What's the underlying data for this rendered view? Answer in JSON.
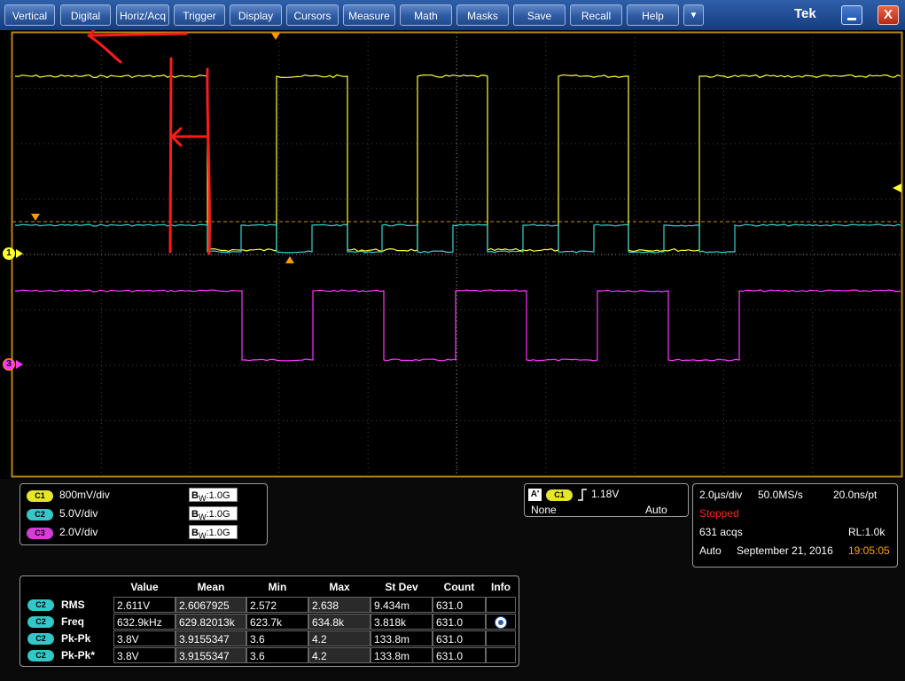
{
  "menu": {
    "items": [
      "Vertical",
      "Digital",
      "Horiz/Acq",
      "Trigger",
      "Display",
      "Cursors",
      "Measure",
      "Math",
      "Masks",
      "Save",
      "Recall",
      "Help"
    ],
    "dropdown_icon": "chevron-down-icon",
    "brand": "Tek",
    "minimize_icon": "minimize-icon",
    "close_label": "X"
  },
  "markers": {
    "ch1": "1",
    "ch3": "3"
  },
  "colors": {
    "ch1": "#ffff33",
    "ch2": "#33d6d6",
    "ch3": "#ff33ff",
    "annotation": "#ff1a1a",
    "trigger_level": "#ff9900",
    "menu_bar": "#1f4a94"
  },
  "channels": [
    {
      "badge": "C1",
      "scale": "800mV/div",
      "bw_b": "B",
      "bw_w": "W",
      "bw_value": ":1.0G",
      "color": "#e5e52b"
    },
    {
      "badge": "C2",
      "scale": "5.0V/div",
      "bw_b": "B",
      "bw_w": "W",
      "bw_value": ":1.0G",
      "color": "#33c8c8"
    },
    {
      "badge": "C3",
      "scale": "2.0V/div",
      "bw_b": "B",
      "bw_w": "W",
      "bw_value": ":1.0G",
      "color": "#d63cd6"
    }
  ],
  "trigger": {
    "badge_a": "A'",
    "badge_ch": "C1",
    "edge_icon": "rising-edge-icon",
    "level": "1.18V",
    "source": "None",
    "mode": "Auto"
  },
  "acquisition": {
    "time_div": "2.0µs/div",
    "sample_rate": "50.0MS/s",
    "resolution": "20.0ns/pt",
    "status": "Stopped",
    "acqs": "631 acqs",
    "record_length": "RL:1.0k",
    "mode": "Auto",
    "date": "September 21, 2016",
    "time": "19:05:05"
  },
  "measurements": {
    "headers": [
      "Value",
      "Mean",
      "Min",
      "Max",
      "St Dev",
      "Count",
      "Info"
    ],
    "rows": [
      {
        "badge": "C2",
        "name": "RMS",
        "cells": [
          "2.611V",
          "2.6067925",
          "2.572",
          "2.638",
          "9.434m",
          "631.0",
          ""
        ]
      },
      {
        "badge": "C2",
        "name": "Freq",
        "cells": [
          "632.9kHz",
          "629.82013k",
          "623.7k",
          "634.8k",
          "3.818k",
          "631.0",
          "info-icon"
        ]
      },
      {
        "badge": "C2",
        "name": "Pk-Pk",
        "cells": [
          "3.8V",
          "3.9155347",
          "3.6",
          "4.2",
          "133.8m",
          "631.0",
          ""
        ]
      },
      {
        "badge": "C2",
        "name": "Pk-Pk*",
        "cells": [
          "3.8V",
          "3.9155347",
          "3.6",
          "4.2",
          "133.8m",
          "631.0",
          ""
        ]
      }
    ]
  }
}
